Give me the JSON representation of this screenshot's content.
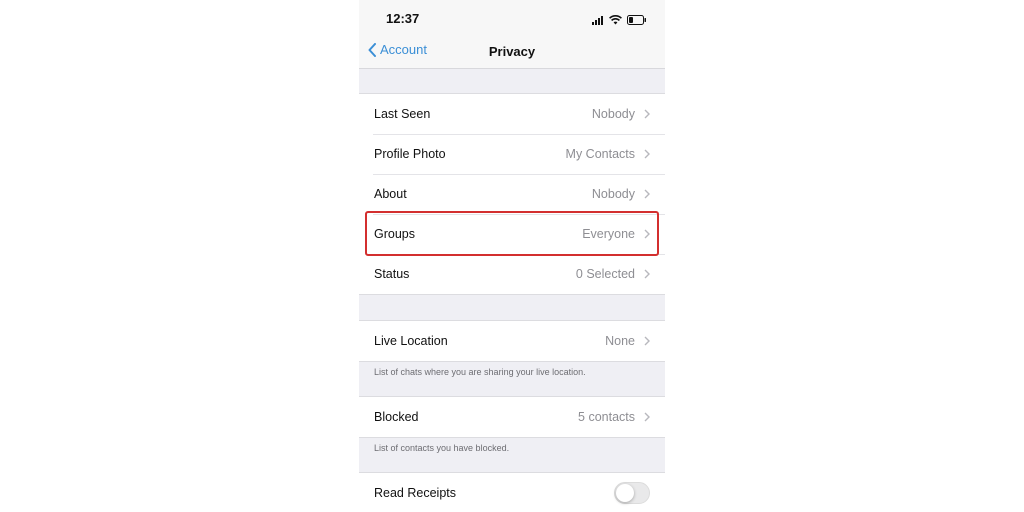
{
  "status_bar": {
    "time": "12:37",
    "icons": [
      "signal-icon",
      "wifi-icon",
      "battery-icon"
    ]
  },
  "nav": {
    "back_label": "Account",
    "title": "Privacy"
  },
  "privacy_items": [
    {
      "label": "Last Seen",
      "value": "Nobody"
    },
    {
      "label": "Profile Photo",
      "value": "My Contacts"
    },
    {
      "label": "About",
      "value": "Nobody"
    },
    {
      "label": "Groups",
      "value": "Everyone",
      "highlighted": true
    },
    {
      "label": "Status",
      "value": "0 Selected"
    }
  ],
  "live_location": {
    "label": "Live Location",
    "value": "None",
    "footnote": "List of chats where you are sharing your live location."
  },
  "blocked": {
    "label": "Blocked",
    "value": "5 contacts",
    "footnote": "List of contacts you have blocked."
  },
  "read_receipts": {
    "label": "Read Receipts",
    "enabled": false
  },
  "colors": {
    "accent": "#3b8fd6",
    "highlight": "#d32f2f",
    "background": "#efeff4"
  }
}
